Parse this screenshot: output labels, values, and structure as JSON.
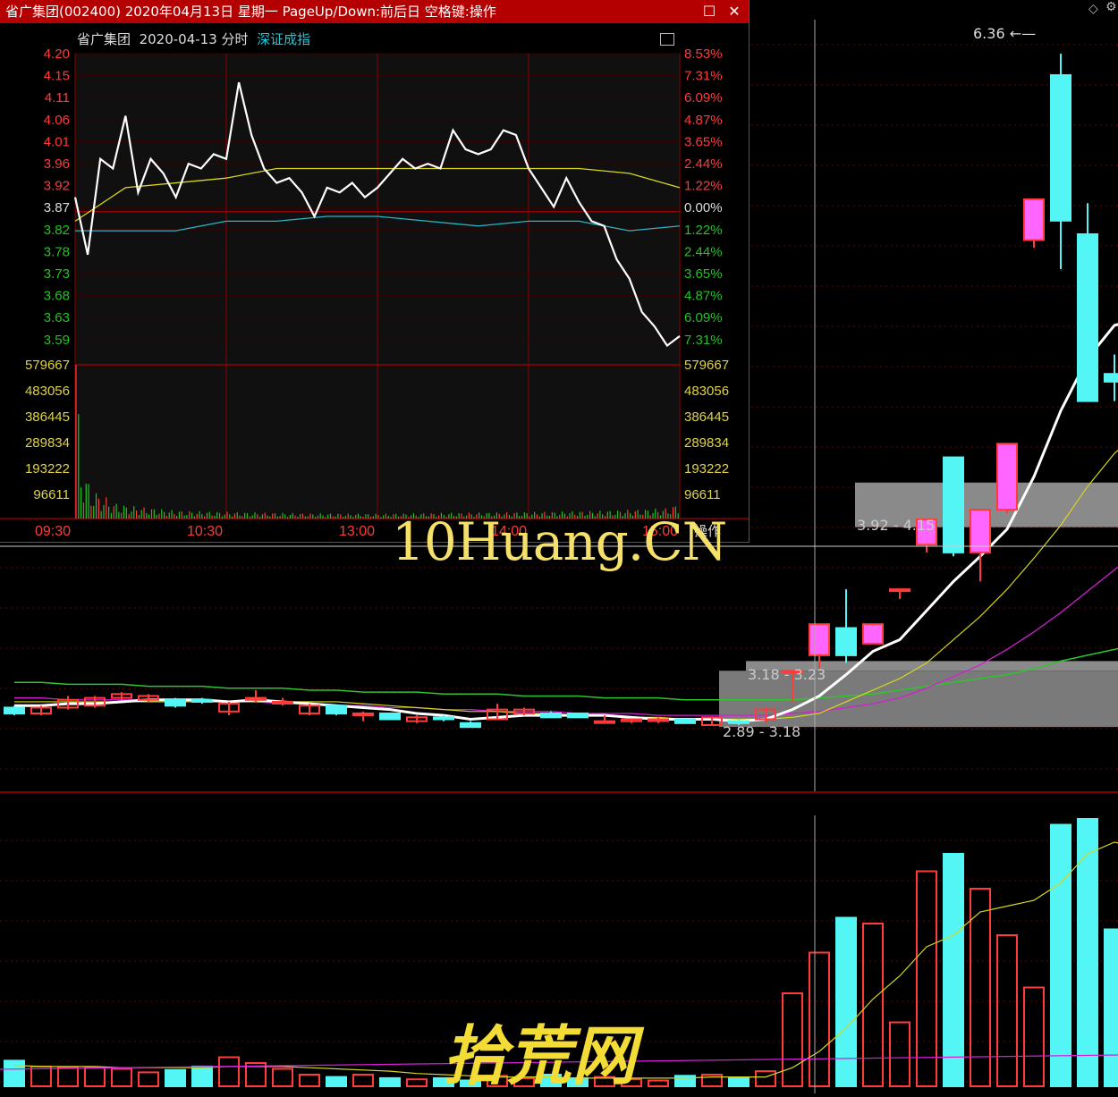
{
  "window": {
    "title": "省广集团(002400) 2020年04月13日 星期一 PageUp/Down:前后日 空格键:操作",
    "subtitle_stock": "省广集团",
    "subtitle_date": "2020-04-13 分时",
    "subtitle_index": "深证成指",
    "close_icon": "close-icon",
    "restore_icon": "restore-icon",
    "operate_label": "操作"
  },
  "kline": {
    "high_label": "6.36",
    "zones": [
      "3.92 - 4.15",
      "3.18 - 3.23",
      "2.89 - 3.18"
    ]
  },
  "watermarks": {
    "top": "10Huang.CN",
    "bottom": "拾荒网"
  },
  "colors": {
    "up": "#ff3b3b",
    "down": "#54f5f5",
    "up_fill": "#ff66ff",
    "price_line": "#ffffff",
    "avg_line": "#d8d81e",
    "index_line": "#2ab4c4",
    "grid": "#8b0000",
    "volume": "#22c322"
  },
  "chart_data": {
    "type": "line",
    "title": "省广集团 2020-04-13 分时",
    "x_ticks": [
      "09:30",
      "10:30",
      "13:00",
      "14:00",
      "15:00"
    ],
    "y_price_ticks": [
      "4.20",
      "4.15",
      "4.11",
      "4.06",
      "4.01",
      "3.96",
      "3.92",
      "3.87",
      "3.82",
      "3.78",
      "3.73",
      "3.68",
      "3.63",
      "3.59"
    ],
    "y_pct_ticks": [
      "8.53%",
      "7.31%",
      "6.09%",
      "4.87%",
      "3.65%",
      "2.44%",
      "1.22%",
      "0.00%",
      "1.22%",
      "2.44%",
      "3.65%",
      "4.87%",
      "6.09%",
      "7.31%"
    ],
    "y_volume_ticks": [
      "579667",
      "483056",
      "386445",
      "289834",
      "193222",
      "96611"
    ],
    "ylim": [
      3.55,
      4.2
    ],
    "prev_close": 3.87,
    "series": [
      {
        "name": "price",
        "x": [
          0,
          5,
          10,
          15,
          20,
          25,
          30,
          35,
          40,
          45,
          50,
          55,
          60,
          65,
          70,
          75,
          80,
          85,
          90,
          95,
          100,
          105,
          110,
          115,
          120,
          125,
          130,
          135,
          140,
          145,
          150,
          155,
          160,
          165,
          170,
          175,
          180,
          185,
          190,
          195,
          200,
          205,
          210,
          215,
          220,
          225,
          230,
          235,
          240
        ],
        "values": [
          3.9,
          3.78,
          3.98,
          3.96,
          4.07,
          3.91,
          3.98,
          3.95,
          3.9,
          3.97,
          3.96,
          3.99,
          3.98,
          4.14,
          4.03,
          3.96,
          3.93,
          3.94,
          3.91,
          3.86,
          3.92,
          3.91,
          3.93,
          3.9,
          3.92,
          3.95,
          3.98,
          3.96,
          3.97,
          3.96,
          4.04,
          4.0,
          3.99,
          4.0,
          4.04,
          4.03,
          3.96,
          3.92,
          3.88,
          3.94,
          3.89,
          3.85,
          3.84,
          3.77,
          3.73,
          3.66,
          3.63,
          3.59,
          3.61
        ]
      },
      {
        "name": "average",
        "x": [
          0,
          20,
          40,
          60,
          80,
          100,
          120,
          140,
          160,
          180,
          200,
          220,
          240
        ],
        "values": [
          3.85,
          3.92,
          3.93,
          3.94,
          3.96,
          3.96,
          3.96,
          3.96,
          3.96,
          3.96,
          3.96,
          3.95,
          3.92
        ]
      },
      {
        "name": "index",
        "x": [
          0,
          20,
          40,
          60,
          80,
          100,
          120,
          140,
          160,
          180,
          200,
          220,
          240
        ],
        "values": [
          3.83,
          3.83,
          3.83,
          3.85,
          3.85,
          3.86,
          3.86,
          3.85,
          3.84,
          3.85,
          3.85,
          3.83,
          3.84
        ]
      }
    ],
    "volume": {
      "x": [
        0,
        2,
        4,
        6,
        8,
        10,
        12,
        15,
        20,
        25,
        30,
        40,
        60,
        90,
        120,
        150,
        180,
        210,
        225,
        235,
        240
      ],
      "values": [
        579667,
        210000,
        160000,
        120000,
        100000,
        90000,
        80000,
        60000,
        50000,
        45000,
        40000,
        30000,
        25000,
        20000,
        18000,
        22000,
        25000,
        30000,
        35000,
        40000,
        60000
      ]
    }
  },
  "candles": [
    {
      "o": 2.99,
      "c": 2.96,
      "h": 3.0,
      "l": 2.95
    },
    {
      "o": 2.96,
      "c": 2.99,
      "h": 3.0,
      "l": 2.95
    },
    {
      "o": 2.99,
      "c": 3.03,
      "h": 3.05,
      "l": 2.98
    },
    {
      "o": 3.0,
      "c": 3.04,
      "h": 3.05,
      "l": 2.99
    },
    {
      "o": 3.04,
      "c": 3.06,
      "h": 3.07,
      "l": 3.03
    },
    {
      "o": 3.03,
      "c": 3.05,
      "h": 3.06,
      "l": 3.02
    },
    {
      "o": 3.03,
      "c": 3.0,
      "h": 3.04,
      "l": 2.99
    },
    {
      "o": 3.03,
      "c": 3.02,
      "h": 3.04,
      "l": 3.01
    },
    {
      "o": 2.97,
      "c": 3.01,
      "h": 3.02,
      "l": 2.95
    },
    {
      "o": 3.03,
      "c": 3.04,
      "h": 3.08,
      "l": 3.02
    },
    {
      "o": 3.02,
      "c": 3.02,
      "h": 3.04,
      "l": 3.0
    },
    {
      "o": 2.96,
      "c": 3.0,
      "h": 3.01,
      "l": 2.95
    },
    {
      "o": 3.0,
      "c": 2.96,
      "h": 3.0,
      "l": 2.95
    },
    {
      "o": 2.96,
      "c": 2.96,
      "h": 2.97,
      "l": 2.92
    },
    {
      "o": 2.96,
      "c": 2.93,
      "h": 2.96,
      "l": 2.93
    },
    {
      "o": 2.92,
      "c": 2.94,
      "h": 2.95,
      "l": 2.91
    },
    {
      "o": 2.94,
      "c": 2.93,
      "h": 2.95,
      "l": 2.92
    },
    {
      "o": 2.91,
      "c": 2.89,
      "h": 2.92,
      "l": 2.89
    },
    {
      "o": 2.93,
      "c": 2.98,
      "h": 3.01,
      "l": 2.93
    },
    {
      "o": 2.96,
      "c": 2.98,
      "h": 2.99,
      "l": 2.95
    },
    {
      "o": 2.96,
      "c": 2.94,
      "h": 2.97,
      "l": 2.94
    },
    {
      "o": 2.96,
      "c": 2.94,
      "h": 2.96,
      "l": 2.94
    },
    {
      "o": 2.92,
      "c": 2.92,
      "h": 2.95,
      "l": 2.92
    },
    {
      "o": 2.92,
      "c": 2.93,
      "h": 2.93,
      "l": 2.91
    },
    {
      "o": 2.93,
      "c": 2.93,
      "h": 2.94,
      "l": 2.91
    },
    {
      "o": 2.93,
      "c": 2.91,
      "h": 2.93,
      "l": 2.91
    },
    {
      "o": 2.9,
      "c": 2.94,
      "h": 2.94,
      "l": 2.9
    },
    {
      "o": 2.92,
      "c": 2.91,
      "h": 2.93,
      "l": 2.9
    },
    {
      "o": 2.93,
      "c": 2.98,
      "h": 2.99,
      "l": 2.91
    },
    {
      "o": 3.18,
      "c": 3.18,
      "h": 3.18,
      "l": 3.02
    },
    {
      "o": 3.26,
      "c": 3.42,
      "h": 3.42,
      "l": 3.19
    },
    {
      "o": 3.4,
      "c": 3.26,
      "h": 3.6,
      "l": 3.22
    },
    {
      "o": 3.32,
      "c": 3.42,
      "h": 3.42,
      "l": 3.32
    },
    {
      "o": 3.6,
      "c": 3.6,
      "h": 3.6,
      "l": 3.55
    },
    {
      "o": 3.83,
      "c": 3.96,
      "h": 3.96,
      "l": 3.79
    },
    {
      "o": 4.28,
      "c": 3.79,
      "h": 4.28,
      "l": 3.77
    },
    {
      "o": 3.79,
      "c": 4.01,
      "h": 4.01,
      "l": 3.64
    },
    {
      "o": 4.01,
      "c": 4.35,
      "h": 4.35,
      "l": 3.99
    },
    {
      "o": 5.4,
      "c": 5.61,
      "h": 5.61,
      "l": 5.36
    },
    {
      "o": 6.25,
      "c": 5.5,
      "h": 6.36,
      "l": 5.25
    },
    {
      "o": 5.43,
      "c": 4.57,
      "h": 5.59,
      "l": 4.57
    },
    {
      "o": 4.71,
      "c": 4.67,
      "h": 4.81,
      "l": 4.57
    },
    {
      "o": 4.45,
      "c": 4.08,
      "h": 4.5,
      "l": 4.03
    }
  ],
  "volumes": [
    22,
    17,
    16,
    16,
    15,
    12,
    14,
    17,
    25,
    20,
    15,
    10,
    8,
    10,
    7,
    6,
    7,
    5,
    9,
    7,
    10,
    7,
    8,
    6,
    5,
    9,
    10,
    7,
    13,
    80,
    115,
    145,
    140,
    55,
    185,
    200,
    170,
    130,
    85,
    225,
    230,
    135,
    125
  ],
  "kline_ma": {
    "ma5": [
      3.0,
      3.0,
      3.01,
      3.01,
      3.02,
      3.03,
      3.03,
      3.03,
      3.02,
      3.03,
      3.02,
      3.01,
      3.0,
      2.99,
      2.98,
      2.96,
      2.95,
      2.93,
      2.94,
      2.95,
      2.95,
      2.95,
      2.95,
      2.94,
      2.93,
      2.93,
      2.93,
      2.92,
      2.93,
      2.98,
      3.05,
      3.16,
      3.28,
      3.34,
      3.49,
      3.64,
      3.77,
      3.91,
      4.18,
      4.52,
      4.79,
      4.96,
      5.0
    ],
    "ma10": [
      3.02,
      3.02,
      3.02,
      3.02,
      3.02,
      3.02,
      3.02,
      3.02,
      3.02,
      3.02,
      3.02,
      3.02,
      3.02,
      3.01,
      3.0,
      2.99,
      2.98,
      2.97,
      2.97,
      2.96,
      2.96,
      2.95,
      2.95,
      2.94,
      2.94,
      2.93,
      2.93,
      2.93,
      2.93,
      2.94,
      2.96,
      3.02,
      3.08,
      3.14,
      3.22,
      3.34,
      3.46,
      3.6,
      3.76,
      3.93,
      4.13,
      4.3,
      4.42
    ],
    "ma20": [
      3.04,
      3.04,
      3.03,
      3.03,
      3.03,
      3.03,
      3.03,
      3.02,
      3.02,
      3.02,
      3.01,
      3.01,
      3.0,
      3.0,
      2.99,
      2.99,
      2.98,
      2.98,
      2.97,
      2.97,
      2.97,
      2.96,
      2.96,
      2.96,
      2.95,
      2.95,
      2.95,
      2.95,
      2.95,
      2.96,
      2.97,
      2.99,
      3.01,
      3.04,
      3.09,
      3.15,
      3.21,
      3.29,
      3.38,
      3.48,
      3.59,
      3.7,
      3.8
    ],
    "ma60": [
      3.12,
      3.12,
      3.11,
      3.11,
      3.11,
      3.1,
      3.1,
      3.1,
      3.09,
      3.09,
      3.09,
      3.08,
      3.08,
      3.07,
      3.07,
      3.07,
      3.06,
      3.06,
      3.06,
      3.05,
      3.05,
      3.05,
      3.04,
      3.04,
      3.04,
      3.03,
      3.03,
      3.03,
      3.03,
      3.03,
      3.04,
      3.05,
      3.06,
      3.08,
      3.1,
      3.12,
      3.14,
      3.16,
      3.19,
      3.23,
      3.26,
      3.29,
      3.32
    ]
  },
  "vol_ma": [
    18,
    17,
    17,
    17,
    16,
    16,
    16,
    16,
    17,
    17,
    17,
    16,
    15,
    14,
    13,
    11,
    10,
    9,
    8,
    8,
    8,
    7,
    7,
    7,
    7,
    7,
    8,
    8,
    8,
    16,
    30,
    50,
    75,
    95,
    120,
    130,
    150,
    155,
    160,
    175,
    200,
    210,
    205
  ]
}
